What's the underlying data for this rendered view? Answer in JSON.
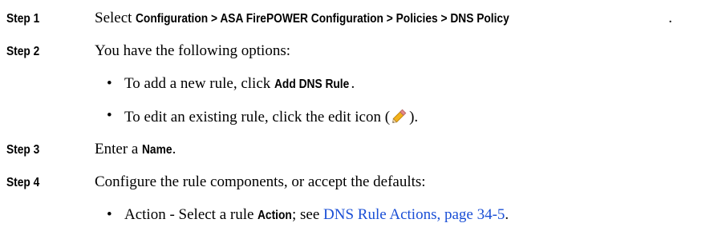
{
  "steps": [
    {
      "label": "Step 1",
      "text": "Select ",
      "path": "Configuration > ASA FirePOWER Configuration > Policies > DNS Policy",
      "end": "."
    },
    {
      "label": "Step 2",
      "text": "You have the following options:",
      "bullets": [
        {
          "pre": "To add a new rule, click ",
          "term": "Add DNS Rule",
          "post": "."
        },
        {
          "pre": "To edit an existing rule, click the edit icon (",
          "icon": "pencil-edit-icon",
          "post": ")."
        }
      ]
    },
    {
      "label": "Step 3",
      "pre": "Enter a ",
      "term": "Name",
      "post": "."
    },
    {
      "label": "Step 4",
      "text": "Configure the rule components, or accept the defaults:",
      "bullets": [
        {
          "pre": "Action - Select a rule ",
          "term": "Action",
          "mid": "; see ",
          "link": "DNS Rule Actions, page 34-5",
          "post": "."
        }
      ]
    }
  ],
  "bullet_char": "•",
  "colors": {
    "link": "#1a4fd6",
    "text": "#000000"
  }
}
